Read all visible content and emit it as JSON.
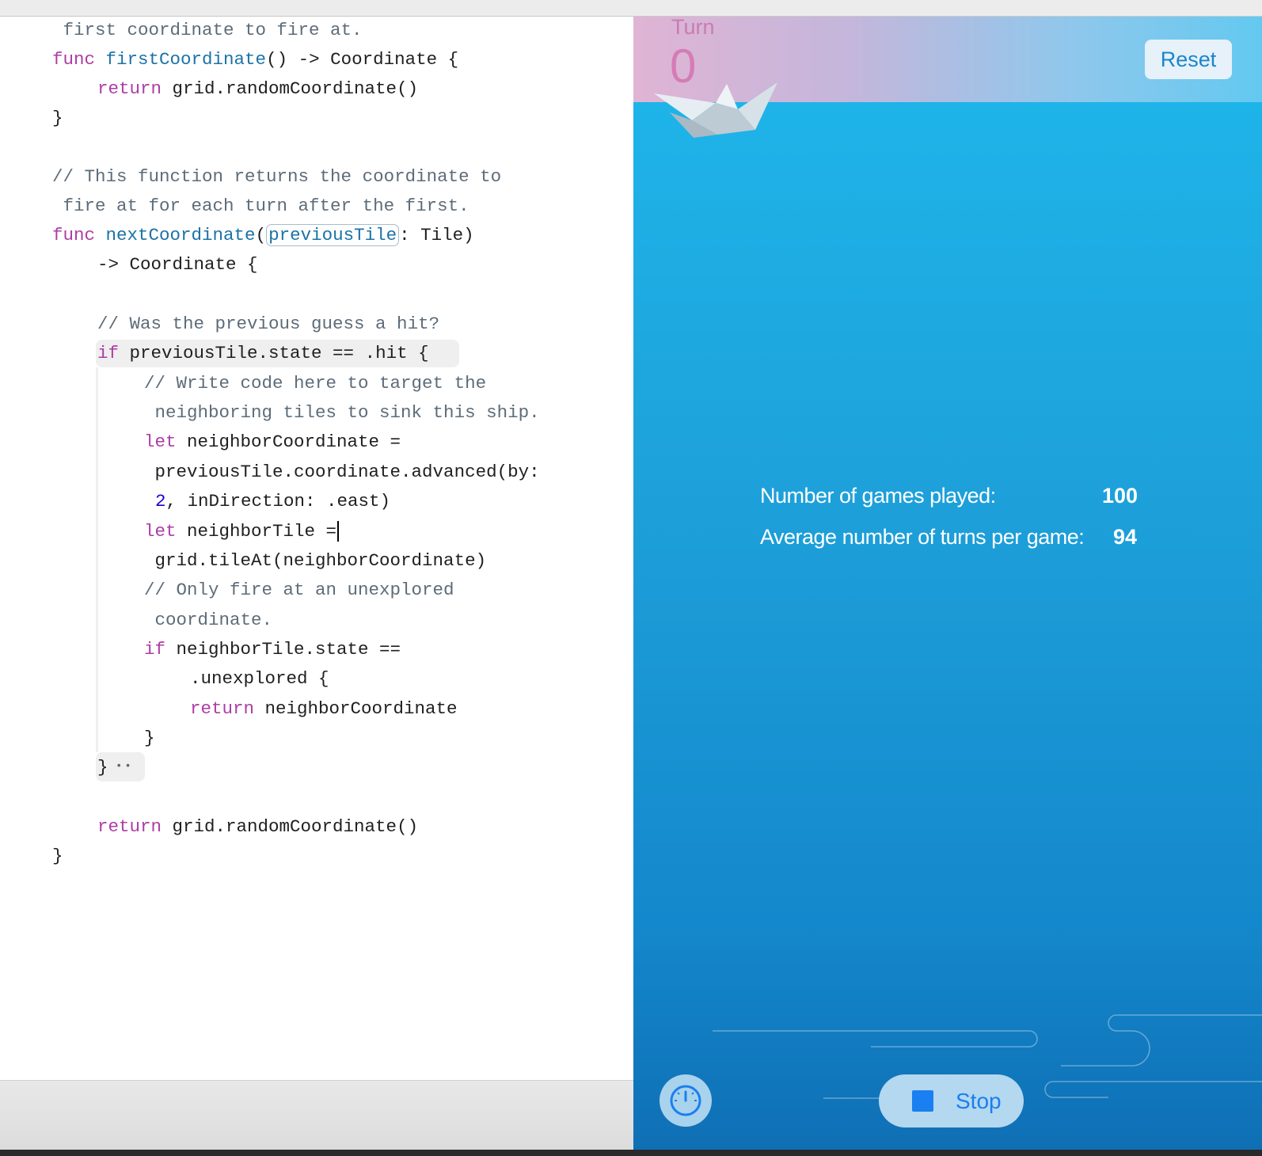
{
  "editor": {
    "lines": {
      "l1": " first coordinate to fire at.",
      "l2_kw": "func",
      "l2_fn": "firstCoordinate",
      "l2_rest": "() -> Coordinate {",
      "l3_kw": "return",
      "l3_rest": " grid.randomCoordinate()",
      "l4": "}",
      "l6": "// This function returns the coordinate to",
      "l7": " fire at for each turn after the first.",
      "l8_kw": "func",
      "l8_fn": "nextCoordinate",
      "l8_open": "(",
      "l8_param": "previousTile",
      "l8_rest": ": Tile)",
      "l9": "-> Coordinate {",
      "l11": "// Was the previous guess a hit?",
      "l12_kw": "if",
      "l12_rest": " previousTile.state == .hit {",
      "l13": "// Write code here to target the",
      "l14": " neighboring tiles to sink this ship.",
      "l15_kw": "let",
      "l15_rest": " neighborCoordinate =",
      "l16": " previousTile.coordinate.advanced(by:",
      "l17_num": "2",
      "l17_rest": ", inDirection: .east)",
      "l18_kw": "let",
      "l18_rest": " neighborTile =",
      "l19": " grid.tileAt(neighborCoordinate)",
      "l20": "// Only fire at an unexplored",
      "l21": " coordinate.",
      "l22_kw": "if",
      "l22_rest": " neighborTile.state ==",
      "l23": ".unexplored {",
      "l24_kw": "return",
      "l24_rest": " neighborCoordinate",
      "l25": "}",
      "l26": "}",
      "l26_dots": "••",
      "l28_kw": "return",
      "l28_rest": " grid.randomCoordinate()",
      "l29": "}"
    }
  },
  "live_view": {
    "turn_label": "Turn",
    "turn_value": "0",
    "reset_label": "Reset",
    "stats": {
      "games_played_label": "Number of games played:",
      "games_played_value": "100",
      "avg_turns_label": "Average number of turns per game:",
      "avg_turns_value": "94"
    },
    "stop_label": "Stop",
    "speed_icon": "speedometer-icon",
    "boat_icon": "paper-boat-icon"
  },
  "colors": {
    "keyword": "#ad3da4",
    "function": "#1b72a8",
    "comment": "#5d6c79",
    "number": "#1c00cf",
    "accent_blue": "#1a7ff0"
  }
}
